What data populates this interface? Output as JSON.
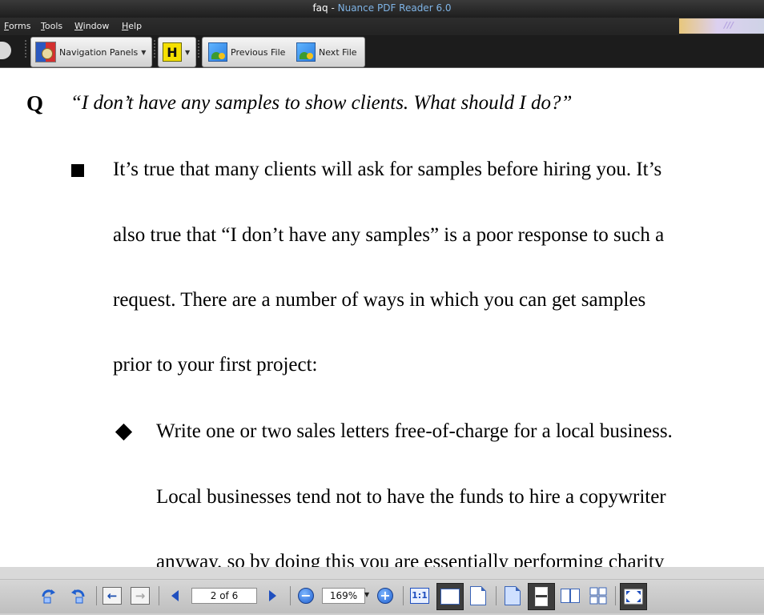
{
  "window": {
    "doc_name": "faq",
    "separator": " - ",
    "app_name": "Nuance PDF Reader 6.0"
  },
  "menu": {
    "items": [
      "Forms",
      "Tools",
      "Window",
      "Help"
    ]
  },
  "toolbar": {
    "navigation_panels_label": "Navigation Panels",
    "highlight_label": "H",
    "previous_file_label": "Previous File",
    "next_file_label": "Next File"
  },
  "document": {
    "q_label": "Q",
    "question": "“I don’t have any samples to show clients. What should I do?”",
    "paragraph_lines": [
      "It’s true that many clients will ask for samples before hiring you. It’s",
      "also true that “I don’t have any samples” is a poor response to such a",
      "request. There are a number of ways in which you can get samples",
      "prior to your first project:"
    ],
    "sub_bullet_lines": [
      "Write one or two sales letters free-of-charge for a local business.",
      "Local businesses tend not to have the funds to hire a copywriter",
      "anyway, so by doing this you are essentially performing charity"
    ]
  },
  "statusbar": {
    "page_indicator": "2 of 6",
    "zoom_value": "169%",
    "actual_size_label": "1:1",
    "zoom_in_symbol": "+",
    "zoom_out_symbol": "−"
  }
}
